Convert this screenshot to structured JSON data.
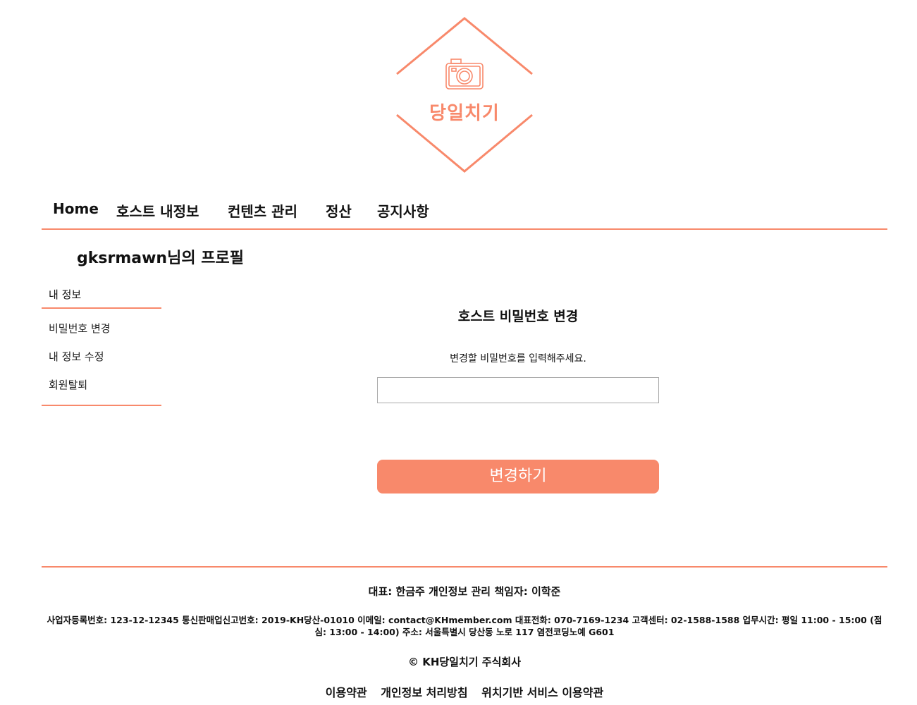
{
  "brand": {
    "logo_text": "당일치기",
    "accent_color": "#f8896b",
    "logo_icon": "camera-icon"
  },
  "nav": {
    "items": [
      {
        "label": "Home"
      },
      {
        "label": "호스트 내정보"
      },
      {
        "label": "컨텐츠 관리"
      },
      {
        "label": "정산"
      },
      {
        "label": "공지사항"
      }
    ]
  },
  "profile": {
    "title": "gksrmawn님의 프로필"
  },
  "sidebar": {
    "heading": "내 정보",
    "items": [
      {
        "label": "비밀번호 변경"
      },
      {
        "label": "내 정보 수정"
      },
      {
        "label": "회원탈퇴"
      }
    ]
  },
  "password_form": {
    "title": "호스트 비밀번호 변경",
    "description": "변경할 비밀번호를 입력해주세요.",
    "input_value": "",
    "submit_label": "변경하기"
  },
  "footer": {
    "representative": "대표: 한금주 개인정보 관리 책임자: 이학준",
    "business_info": "사업자등록번호: 123-12-12345 통신판매업신고번호: 2019-KH당산-01010 이메일: contact@KHmember.com 대표전화: 070-7169-1234 고객센터: 02-1588-1588 업무시간: 평일 11:00 - 15:00 (점심: 13:00 - 14:00) 주소: 서울특별시 당산동 노로 117 염전코딩노예 G601",
    "copyright": "© KH당일치기 주식회사",
    "links": [
      {
        "label": "이용약관"
      },
      {
        "label": "개인정보 처리방침"
      },
      {
        "label": "위치기반 서비스 이용약관"
      }
    ]
  }
}
